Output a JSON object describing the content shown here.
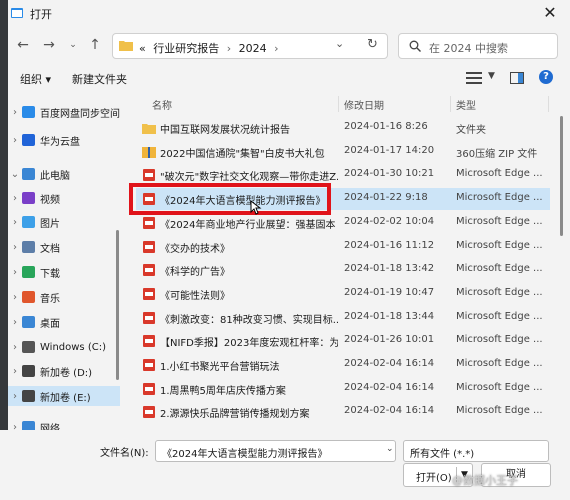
{
  "window": {
    "title": "打开"
  },
  "nav": {
    "address_prefix": "«",
    "path": [
      "行业研究报告",
      "2024"
    ],
    "path_separator": "›",
    "search_placeholder": "在 2024 中搜索"
  },
  "toolbar": {
    "organize": "组织 ▾",
    "new_folder": "新建文件夹"
  },
  "sidebar": {
    "items": [
      {
        "label": "百度网盘同步空间",
        "chevron": "›",
        "icon": "baidu-cloud-icon",
        "color": "#2a8be8"
      },
      {
        "label": "华为云盘",
        "chevron": "›",
        "icon": "huawei-cloud-icon",
        "color": "#2064d8"
      },
      {
        "label": "此电脑",
        "chevron": "⌄",
        "icon": "computer-icon",
        "color": "#3a86d4"
      },
      {
        "label": "视频",
        "chevron": "›",
        "icon": "video-folder-icon",
        "color": "#7a3fc8"
      },
      {
        "label": "图片",
        "chevron": "›",
        "icon": "pictures-folder-icon",
        "color": "#3da0e8"
      },
      {
        "label": "文档",
        "chevron": "›",
        "icon": "documents-folder-icon",
        "color": "#5d7ea8"
      },
      {
        "label": "下载",
        "chevron": "›",
        "icon": "downloads-folder-icon",
        "color": "#28a55a"
      },
      {
        "label": "音乐",
        "chevron": "›",
        "icon": "music-folder-icon",
        "color": "#e0562c"
      },
      {
        "label": "桌面",
        "chevron": "›",
        "icon": "desktop-folder-icon",
        "color": "#3a86d4"
      },
      {
        "label": "Windows (C:)",
        "chevron": "›",
        "icon": "drive-icon",
        "color": "#555555"
      },
      {
        "label": "新加卷 (D:)",
        "chevron": "›",
        "icon": "drive-icon",
        "color": "#444444"
      },
      {
        "label": "新加卷 (E:)",
        "chevron": "›",
        "icon": "drive-icon",
        "color": "#444444",
        "selected": true
      },
      {
        "label": "网络",
        "chevron": "›",
        "icon": "network-icon",
        "color": "#3a86d4"
      }
    ]
  },
  "list": {
    "headers": {
      "name": "名称",
      "date": "修改日期",
      "type": "类型"
    },
    "rows": [
      {
        "name": "中国互联网发展状况统计报告",
        "date": "2024-01-16 8:26",
        "type": "文件夹",
        "icon": "folder-icon"
      },
      {
        "name": "2022中国信通院\"集智\"白皮书大礼包",
        "date": "2024-01-17 14:20",
        "type": "360压缩 ZIP 文件",
        "icon": "zip-icon"
      },
      {
        "name": "\"破次元\"数字社交文化观察—带你走进Z...",
        "date": "2024-01-30 10:21",
        "type": "Microsoft Edge ...",
        "icon": "pdf-icon"
      },
      {
        "name": "《2024年大语言模型能力测评报告》",
        "date": "2024-01-22 9:18",
        "type": "Microsoft Edge ...",
        "icon": "pdf-icon",
        "selected": true
      },
      {
        "name": "《2024年商业地产行业展望：强基固本 ...",
        "date": "2024-02-02 10:04",
        "type": "Microsoft Edge ...",
        "icon": "pdf-icon"
      },
      {
        "name": "《交办的技术》",
        "date": "2024-01-16 11:12",
        "type": "Microsoft Edge ...",
        "icon": "pdf-icon"
      },
      {
        "name": "《科学的广告》",
        "date": "2024-01-18 13:42",
        "type": "Microsoft Edge ...",
        "icon": "pdf-icon"
      },
      {
        "name": "《可能性法则》",
        "date": "2024-01-19 10:47",
        "type": "Microsoft Edge ...",
        "icon": "pdf-icon"
      },
      {
        "name": "《刺激改变：81种改变习惯、实现目标...",
        "date": "2024-01-18 13:44",
        "type": "Microsoft Edge ...",
        "icon": "pdf-icon"
      },
      {
        "name": "【NIFD季报】2023年度宏观杠杆率：为...",
        "date": "2024-01-26 10:01",
        "type": "Microsoft Edge ...",
        "icon": "pdf-icon"
      },
      {
        "name": "1.小红书聚光平台营销玩法",
        "date": "2024-02-04 16:14",
        "type": "Microsoft Edge ...",
        "icon": "pdf-icon"
      },
      {
        "name": "1.周黑鸭5周年店庆传播方案",
        "date": "2024-02-04 16:14",
        "type": "Microsoft Edge ...",
        "icon": "pdf-icon"
      },
      {
        "name": "2.源源快乐品牌营销传播规划方案",
        "date": "2024-02-04 16:14",
        "type": "Microsoft Edge ...",
        "icon": "pdf-icon"
      }
    ]
  },
  "bottom": {
    "filename_label": "文件名(N):",
    "filename_value": "《2024年大语言模型能力测评报告》",
    "filetype_value": "所有文件 (*.*)",
    "open_label": "打开(O)",
    "cancel_label": "取消"
  },
  "watermark": "@数据小王子",
  "colors": {
    "highlight": "#e0131a",
    "selection": "#cce4f7",
    "folder": "#f0c04a",
    "pdf": "#d9382a"
  }
}
